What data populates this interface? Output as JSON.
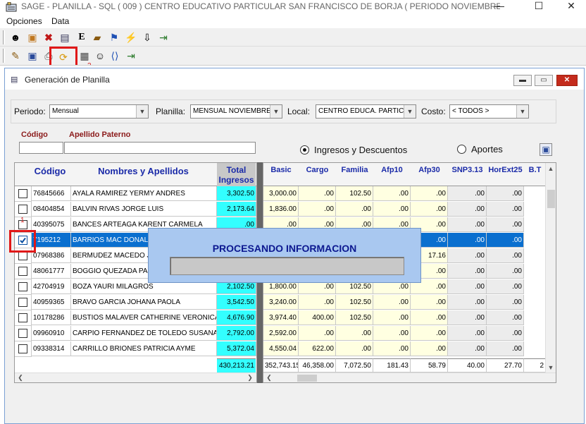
{
  "window": {
    "title": "SAGE - PLANILLA - SQL  ( 009 ) CENTRO EDUCATIVO PARTICULAR  SAN FRANCISCO DE BORJA ( PERIODO NOVIEMBRE 2023 ...",
    "minimize": "—",
    "maximize": "☐",
    "close": "✕"
  },
  "menu": {
    "items": [
      "Opciones",
      "Data"
    ]
  },
  "toolbar1": {
    "icons": [
      "users-icon",
      "box-icon",
      "cross-icon",
      "table-icon",
      "help-e-icon",
      "book-icon",
      "run-icon",
      "lightning-icon",
      "download-icon",
      "exit-icon"
    ]
  },
  "toolbar2": {
    "icons": [
      "edit-icon",
      "save-icon",
      "print-icon",
      "process-icon",
      "preview-icon",
      "people-icon",
      "code-icon",
      "exit-icon"
    ],
    "annotation": "2"
  },
  "child_window": {
    "title": "Generación de Planilla",
    "minimize": "▬",
    "maximize": "▭",
    "close": "✕"
  },
  "filters": {
    "periodo_label": "Periodo:",
    "periodo_value": "Mensual",
    "planilla_label": "Planilla:",
    "planilla_value": "MENSUAL NOVIEMBRE",
    "local_label": "Local:",
    "local_value": "CENTRO EDUCA. PARTIC",
    "costo_label": "Costo:",
    "costo_value": "< TODOS >"
  },
  "search": {
    "codigo_label": "Código",
    "apellido_label": "Apellido Paterno"
  },
  "options": {
    "ingresos": "Ingresos y Descuentos",
    "aportes": "Aportes"
  },
  "left_grid": {
    "headers": {
      "codigo": "Código",
      "nombres": "Nombres y Apellidos",
      "total": "Total Ingresos"
    },
    "annotation": "1",
    "rows": [
      {
        "codigo": "76845666",
        "nombre": "AYALA RAMIREZ YERMY ANDRES",
        "total": "3,302.50",
        "checked": false,
        "selected": false
      },
      {
        "codigo": "08404854",
        "nombre": "BALVIN RIVAS JORGE LUIS",
        "total": "2,173.64",
        "checked": false,
        "selected": false
      },
      {
        "codigo": "40395075",
        "nombre": "BANCES ARTEAGA KARENT CARMELA",
        "total": ".00",
        "checked": false,
        "selected": false
      },
      {
        "codigo": "7195212",
        "nombre": "BARRIOS MAC DONALD VI",
        "total": "",
        "checked": true,
        "selected": true
      },
      {
        "codigo": "07968386",
        "nombre": "BERMUDEZ MACEDO JOS",
        "total": "",
        "checked": false,
        "selected": false
      },
      {
        "codigo": "48061777",
        "nombre": "BOGGIO QUEZADA PAOLA",
        "total": "",
        "checked": false,
        "selected": false
      },
      {
        "codigo": "42704919",
        "nombre": "BOZA YAURI MILAGROS",
        "total": "2,102.50",
        "checked": false,
        "selected": false
      },
      {
        "codigo": "40959365",
        "nombre": "BRAVO  GARCIA JOHANA PAOLA",
        "total": "3,542.50",
        "checked": false,
        "selected": false
      },
      {
        "codigo": "10178286",
        "nombre": "BUSTIOS MALAVER CATHERINE VERONICA",
        "total": "4,676.90",
        "checked": false,
        "selected": false
      },
      {
        "codigo": "09960910",
        "nombre": "CARPIO FERNANDEZ DE TOLEDO SUSANA ELIZ",
        "total": "2,792.00",
        "checked": false,
        "selected": false
      },
      {
        "codigo": "09338314",
        "nombre": "CARRILLO BRIONES PATRICIA AYME",
        "total": "5,372.04",
        "checked": false,
        "selected": false
      }
    ],
    "footer_total": "430,213.21"
  },
  "right_grid": {
    "headers": [
      "Basic",
      "Cargo",
      "Familia",
      "Afp10",
      "Afp30",
      "SNP3.13",
      "HorExt25",
      "B.T"
    ],
    "rows": [
      [
        "3,000.00",
        ".00",
        "102.50",
        ".00",
        ".00",
        ".00",
        ".00"
      ],
      [
        "1,836.00",
        ".00",
        ".00",
        ".00",
        ".00",
        ".00",
        ".00"
      ],
      [
        ".00",
        ".00",
        ".00",
        ".00",
        ".00",
        ".00",
        ".00"
      ],
      [
        "",
        "",
        "",
        "",
        ".00",
        ".00",
        ".00"
      ],
      [
        "",
        "",
        "",
        "",
        "17.16",
        ".00",
        ".00"
      ],
      [
        "",
        "",
        "",
        "",
        ".00",
        ".00",
        ".00"
      ],
      [
        "1,800.00",
        ".00",
        "102.50",
        ".00",
        ".00",
        ".00",
        ".00"
      ],
      [
        "3,240.00",
        ".00",
        "102.50",
        ".00",
        ".00",
        ".00",
        ".00"
      ],
      [
        "3,974.40",
        "400.00",
        "102.50",
        ".00",
        ".00",
        ".00",
        ".00"
      ],
      [
        "2,592.00",
        ".00",
        ".00",
        ".00",
        ".00",
        ".00",
        ".00"
      ],
      [
        "4,550.04",
        "622.00",
        ".00",
        ".00",
        ".00",
        ".00",
        ".00"
      ]
    ],
    "footer": [
      "352,743.15",
      "46,358.00",
      "7,072.50",
      "181.43",
      "58.79",
      "40.00",
      "27.70",
      "2"
    ]
  },
  "progress": {
    "title": "PROCESANDO INFORMACION"
  },
  "colors": {
    "selected_row": "#0a6fcf",
    "total_cyan": "#33ffff",
    "annotation_red": "#e01818",
    "dialog_blue": "#a9c8f0"
  }
}
